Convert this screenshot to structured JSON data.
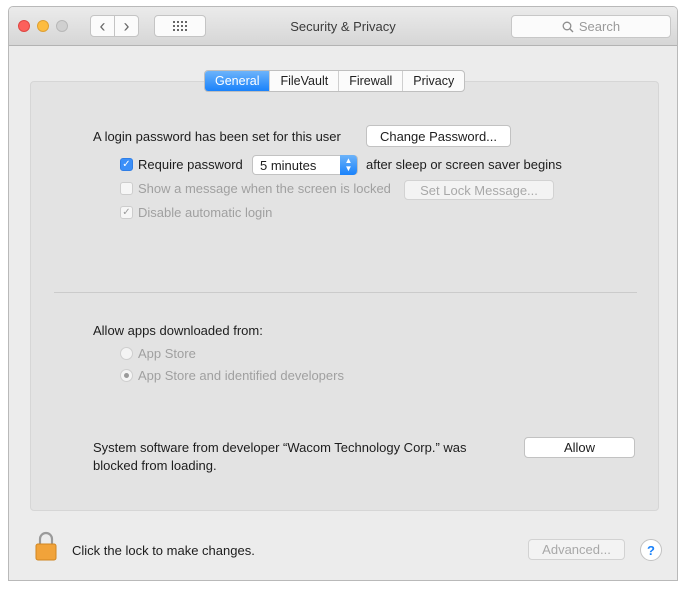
{
  "window": {
    "title": "Security & Privacy",
    "search_placeholder": "Search",
    "nav_back": "‹",
    "nav_forward": "›"
  },
  "tabs": [
    {
      "label": "General",
      "active": true
    },
    {
      "label": "FileVault",
      "active": false
    },
    {
      "label": "Firewall",
      "active": false
    },
    {
      "label": "Privacy",
      "active": false
    }
  ],
  "general": {
    "login_text": "A login password has been set for this user",
    "change_password_label": "Change Password...",
    "require_password": {
      "label": "Require password",
      "checked": true
    },
    "require_interval": "5 minutes",
    "after_sleep_text": "after sleep or screen saver begins",
    "show_message": {
      "label": "Show a message when the screen is locked",
      "checked": false,
      "enabled": false
    },
    "set_lock_message_label": "Set Lock Message...",
    "disable_auto_login": {
      "label": "Disable automatic login",
      "checked": true,
      "enabled": false
    }
  },
  "allow_apps": {
    "heading": "Allow apps downloaded from:",
    "options": [
      {
        "label": "App Store",
        "selected": false
      },
      {
        "label": "App Store and identified developers",
        "selected": true
      }
    ]
  },
  "blocked": {
    "line1": "System software from developer “Wacom Technology Corp.” was",
    "line2": "blocked from loading.",
    "allow_label": "Allow"
  },
  "footer": {
    "lock_text": "Click the lock to make changes.",
    "advanced_label": "Advanced...",
    "help_label": "?"
  },
  "colors": {
    "accent": "#1a82fb",
    "lock": "#f1a33a"
  }
}
